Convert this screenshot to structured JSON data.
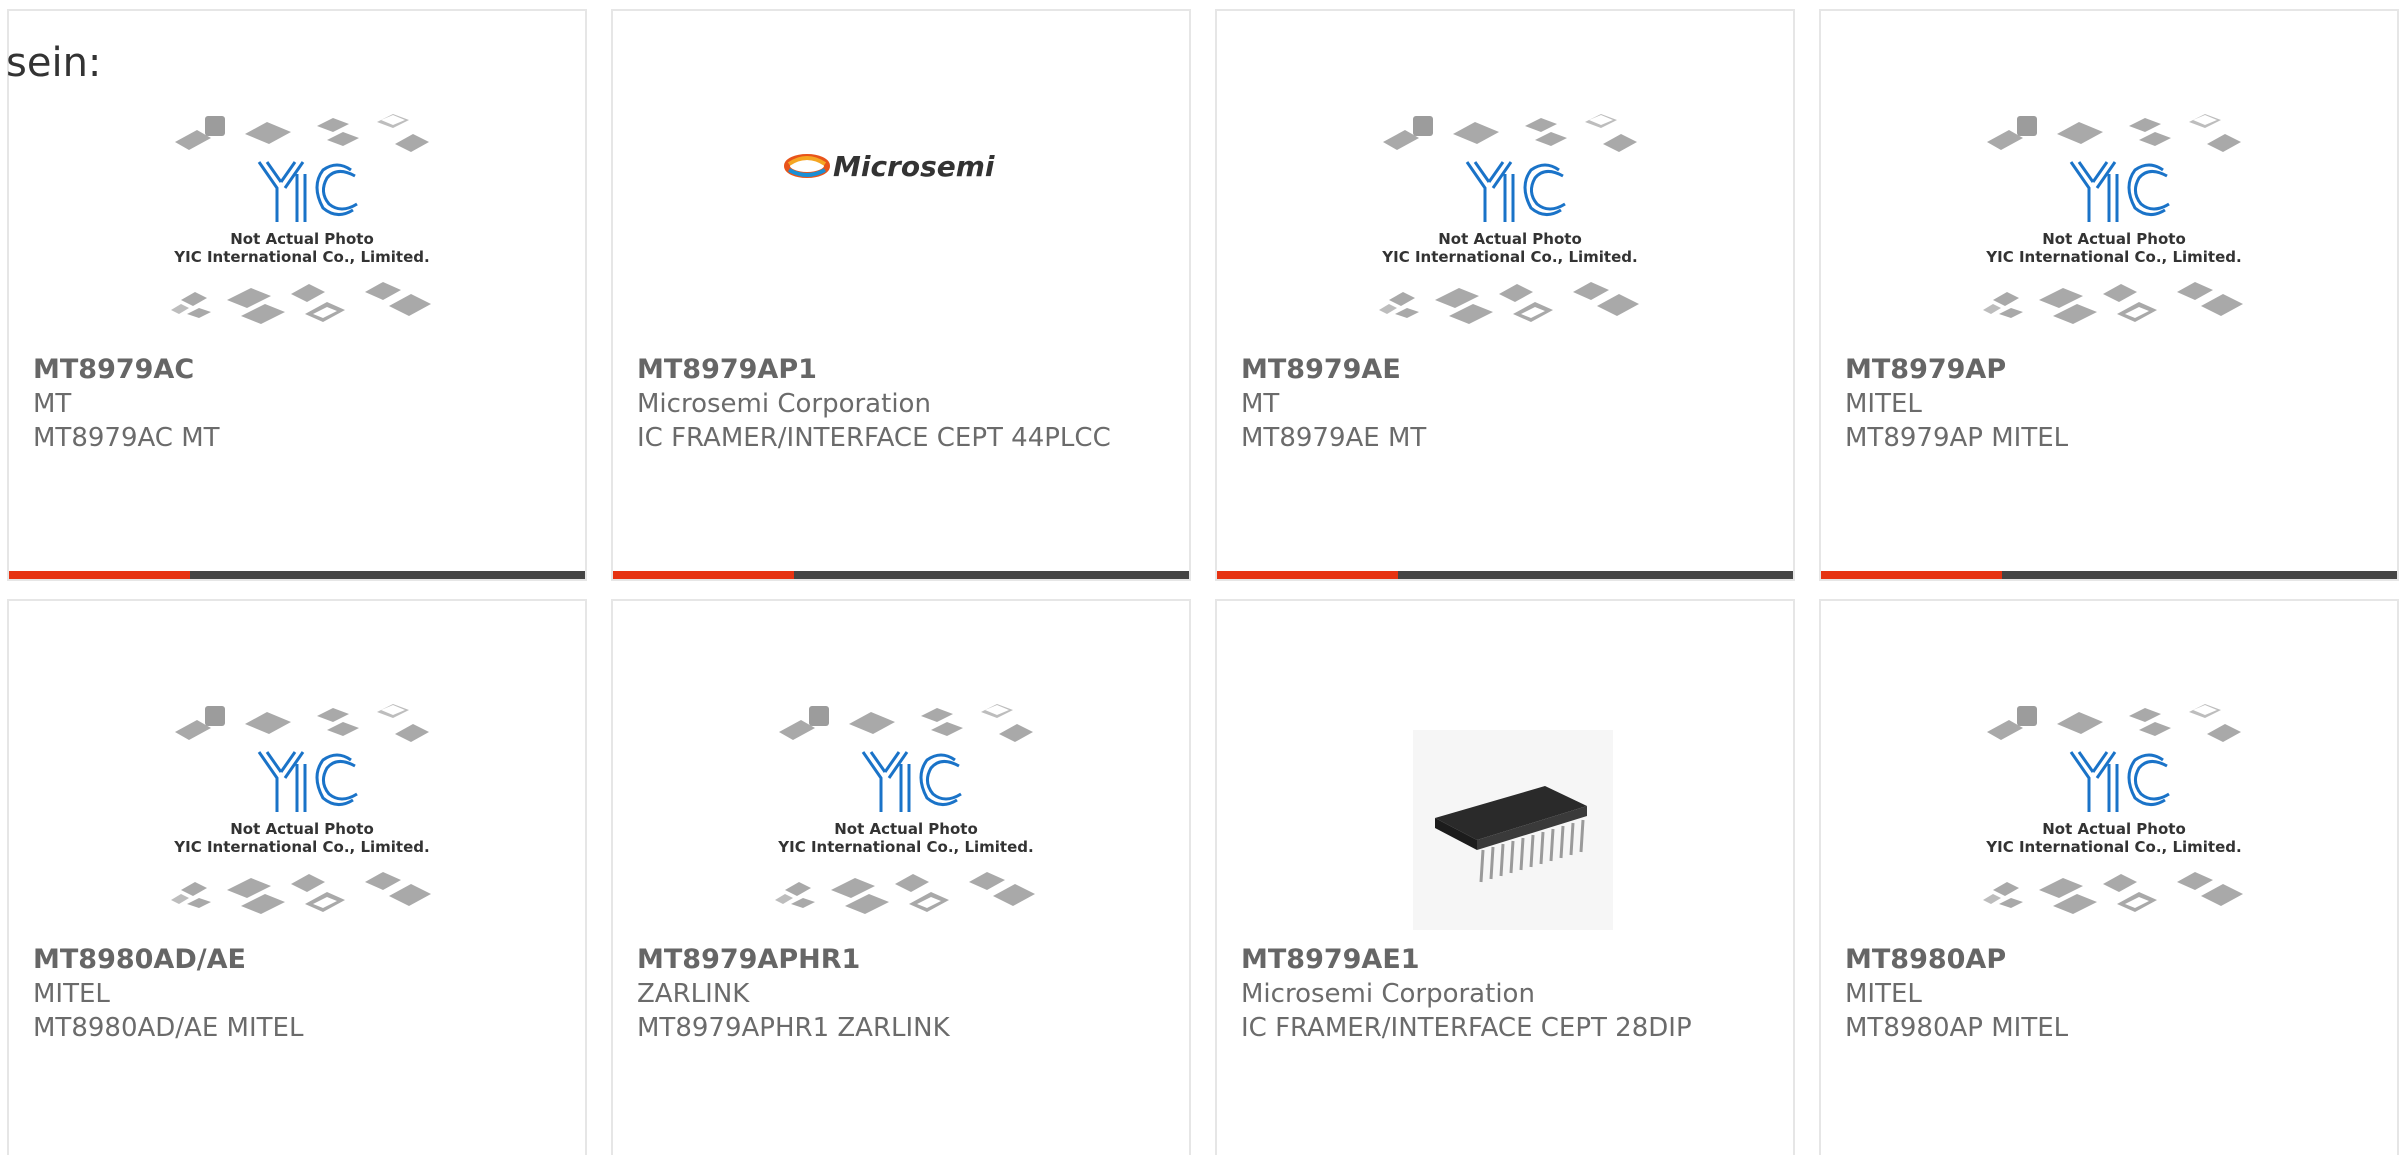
{
  "intro_text": "sein:",
  "placeholder_caption": {
    "line1": "Not Actual Photo",
    "line2": "YIC International Co., Limited."
  },
  "brand_logo_text": "Microsemi",
  "colors": {
    "accent": "#e63312",
    "bar": "#444444",
    "text": "#6b6b6b",
    "logo_blue": "#1a73c8"
  },
  "products": [
    {
      "part": "MT8979AC",
      "maker": "MT",
      "desc": "MT8979AC MT",
      "image": "yic-placeholder"
    },
    {
      "part": "MT8979AP1",
      "maker": "Microsemi Corporation",
      "desc": "IC FRAMER/INTERFACE CEPT 44PLCC",
      "image": "microsemi-logo"
    },
    {
      "part": "MT8979AE",
      "maker": "MT",
      "desc": "MT8979AE MT",
      "image": "yic-placeholder"
    },
    {
      "part": "MT8979AP",
      "maker": "MITEL",
      "desc": "MT8979AP MITEL",
      "image": "yic-placeholder"
    },
    {
      "part": "MT8980AD/AE",
      "maker": "MITEL",
      "desc": "MT8980AD/AE MITEL",
      "image": "yic-placeholder"
    },
    {
      "part": "MT8979APHR1",
      "maker": "ZARLINK",
      "desc": "MT8979APHR1 ZARLINK",
      "image": "yic-placeholder"
    },
    {
      "part": "MT8979AE1",
      "maker": "Microsemi Corporation",
      "desc": "IC FRAMER/INTERFACE CEPT 28DIP",
      "image": "dip-chip-photo"
    },
    {
      "part": "MT8980AP",
      "maker": "MITEL",
      "desc": "MT8980AP MITEL",
      "image": "yic-placeholder"
    }
  ]
}
